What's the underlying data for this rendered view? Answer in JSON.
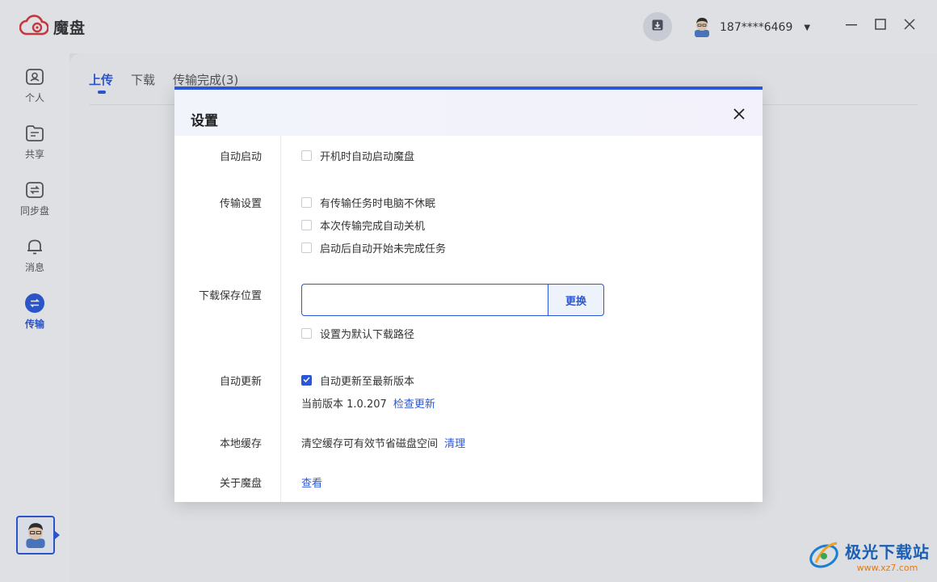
{
  "app": {
    "name": "魔盘"
  },
  "user": {
    "phone": "187****6469"
  },
  "sidebar": {
    "items": [
      {
        "label": "个人",
        "icon": "person-folder-icon"
      },
      {
        "label": "共享",
        "icon": "share-folder-icon"
      },
      {
        "label": "同步盘",
        "icon": "sync-icon"
      },
      {
        "label": "消息",
        "icon": "bell-icon"
      },
      {
        "label": "传输",
        "icon": "transfer-icon",
        "active": true
      }
    ]
  },
  "main": {
    "tabs": [
      {
        "label": "上传",
        "active": true
      },
      {
        "label": "下载"
      },
      {
        "label": "传输完成(3)"
      }
    ]
  },
  "dialog": {
    "title": "设置",
    "sections": {
      "autostart": {
        "label": "自动启动",
        "option": "开机时自动启动魔盘",
        "checked": false
      },
      "transfer": {
        "label": "传输设置",
        "options": [
          {
            "text": "有传输任务时电脑不休眠",
            "checked": false
          },
          {
            "text": "本次传输完成自动关机",
            "checked": false
          },
          {
            "text": "启动后自动开始未完成任务",
            "checked": false
          }
        ]
      },
      "download_location": {
        "label": "下载保存位置",
        "path": "",
        "change_button": "更换",
        "default_option": "设置为默认下载路径",
        "checked": false
      },
      "auto_update": {
        "label": "自动更新",
        "option": "自动更新至最新版本",
        "checked": true,
        "version_text": "当前版本 1.0.207",
        "check_link": "检查更新"
      },
      "cache": {
        "label": "本地缓存",
        "text": "清空缓存可有效节省磁盘空间",
        "clear_link": "清理"
      },
      "about": {
        "label": "关于魔盘",
        "view_link": "查看"
      }
    }
  },
  "watermark": {
    "title": "极光下载站",
    "url": "www.xz7.com"
  },
  "colors": {
    "accent": "#2a57d9",
    "logo_red": "#d9363e"
  }
}
